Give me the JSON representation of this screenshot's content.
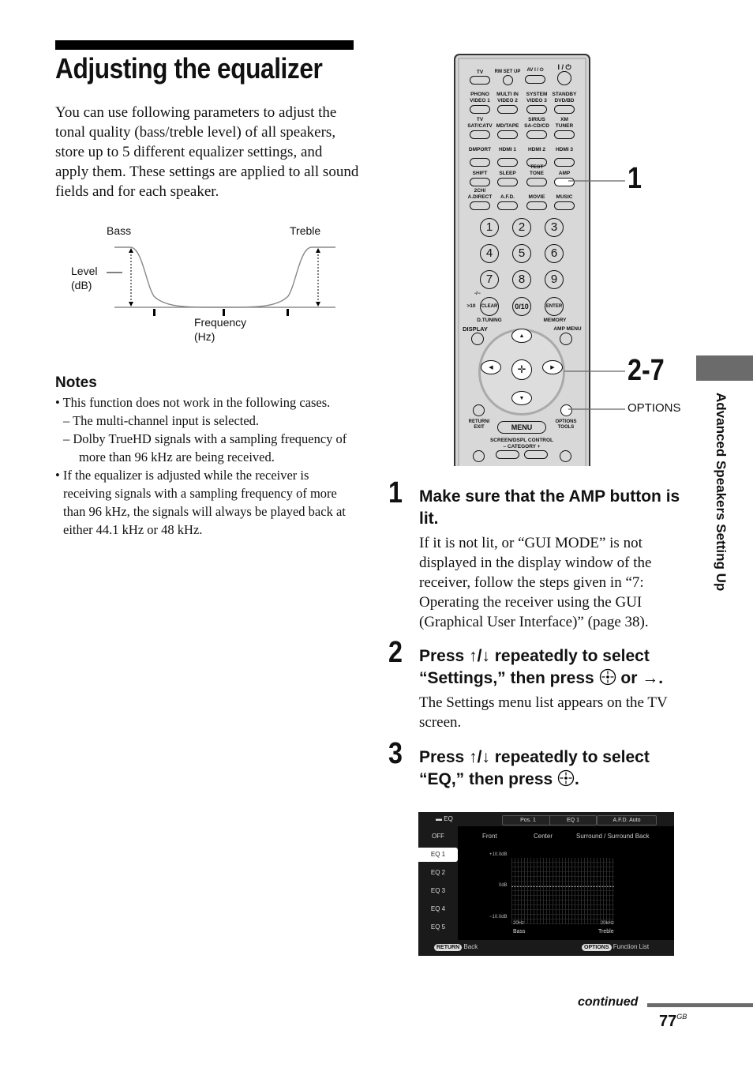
{
  "page": {
    "title": "Adjusting the equalizer",
    "intro": "You can use following parameters to adjust the tonal quality (bass/treble level) of all speakers, store up to 5 different equalizer settings, and apply them. These settings are applied to all sound fields and for each speaker.",
    "section_tab": "Advanced Speakers Setting Up",
    "continued": "continued",
    "page_number": "77",
    "page_suffix": "GB"
  },
  "diagram": {
    "bass": "Bass",
    "treble": "Treble",
    "level_line1": "Level",
    "level_line2": "(dB)",
    "freq_line1": "Frequency",
    "freq_line2": "(Hz)"
  },
  "notes": {
    "title": "Notes",
    "items": [
      "• This function does not work in the following cases.",
      "–  The multi-channel input is selected.",
      "–  Dolby TrueHD signals with a sampling frequency of more than 96 kHz are being received.",
      "• If the equalizer is adjusted while the receiver is receiving signals with a sampling frequency of more than 96 kHz, the signals will always be played back at either 44.1 kHz or 48 kHz."
    ]
  },
  "remote": {
    "callouts": {
      "c1": "1",
      "c2": "2-7",
      "options": "OPTIONS"
    },
    "row1": [
      "TV",
      "RM SET UP",
      "AV I / ⏻",
      "I / ⏻"
    ],
    "row2": [
      [
        "PHONO",
        "VIDEO 1"
      ],
      [
        "MULTI IN",
        "VIDEO 2"
      ],
      [
        "SYSTEM",
        "VIDEO 3"
      ],
      [
        "STANDBY",
        "DVD/BD"
      ]
    ],
    "row3": [
      [
        "TV",
        "SAT/CATV"
      ],
      [
        "",
        "MD/TAPE"
      ],
      [
        "SIRIUS",
        "SA-CD/CD"
      ],
      [
        "XM",
        "TUNER"
      ]
    ],
    "row4": [
      "DMPORT",
      "HDMI 1",
      "HDMI 2",
      "HDMI 3"
    ],
    "row5": [
      [
        "",
        "SHIFT"
      ],
      [
        "",
        "SLEEP"
      ],
      [
        "TEST",
        "TONE"
      ],
      [
        "",
        "AMP"
      ]
    ],
    "row6": [
      [
        "2CH/",
        "A.DIRECT"
      ],
      [
        "",
        "A.F.D."
      ],
      [
        "",
        "MOVIE"
      ],
      [
        "",
        "MUSIC"
      ]
    ],
    "digits": [
      "1",
      "2",
      "3",
      "4",
      "5",
      "6",
      "7",
      "8",
      "9"
    ],
    "clear": "CLEAR",
    "zero": "0/10",
    "enter": "ENTER",
    "gt10": ">10",
    "dash": "-/--",
    "d_tuning": "D.TUNING",
    "memory": "MEMORY",
    "display": "DISPLAY",
    "amp_menu": "AMP MENU",
    "return_exit": [
      "RETURN/",
      "EXIT"
    ],
    "menu": "MENU",
    "options_tools": [
      "OPTIONS",
      "TOOLS"
    ],
    "screen_control": "SCREEN/DSPL CONTROL",
    "category": "–  CATEGORY  +"
  },
  "steps": [
    {
      "num": "1",
      "head": "Make sure that the AMP button is lit.",
      "body": "If it is not lit, or “GUI MODE” is not displayed in the display window of the receiver, follow the steps given in “7: Operating the receiver using the GUI (Graphical User Interface)” (page 38)."
    },
    {
      "num": "2",
      "head_a": "Press ",
      "head_arrows": "↑/↓",
      "head_b": " repeatedly to select “Settings,” then press ",
      "head_or": " or ",
      "head_right": "→",
      "head_end": ".",
      "body": "The Settings menu list appears on the TV screen."
    },
    {
      "num": "3",
      "head_a": "Press ",
      "head_arrows": "↑/↓",
      "head_b": " repeatedly to select “EQ,” then press ",
      "head_end": "."
    }
  ],
  "gui": {
    "title": "EQ",
    "tabs": [
      "Pos. 1",
      "EQ 1",
      "A.F.D. Auto"
    ],
    "menu": [
      "OFF",
      "EQ 1",
      "EQ 2",
      "EQ 3",
      "EQ 4",
      "EQ 5"
    ],
    "selected": "EQ 1",
    "columns": [
      "Front",
      "Center",
      "Surround / Surround Back"
    ],
    "y_top": "+10.0dB",
    "y_mid": "0dB",
    "y_bottom": "−10.0dB",
    "x_left": "20Hz",
    "x_right": "20kHz",
    "bass": "Bass",
    "treble": "Treble",
    "footer_left_btn": "RETURN",
    "footer_left": "Back",
    "footer_right_btn": "OPTIONS",
    "footer_right": "Function List"
  }
}
